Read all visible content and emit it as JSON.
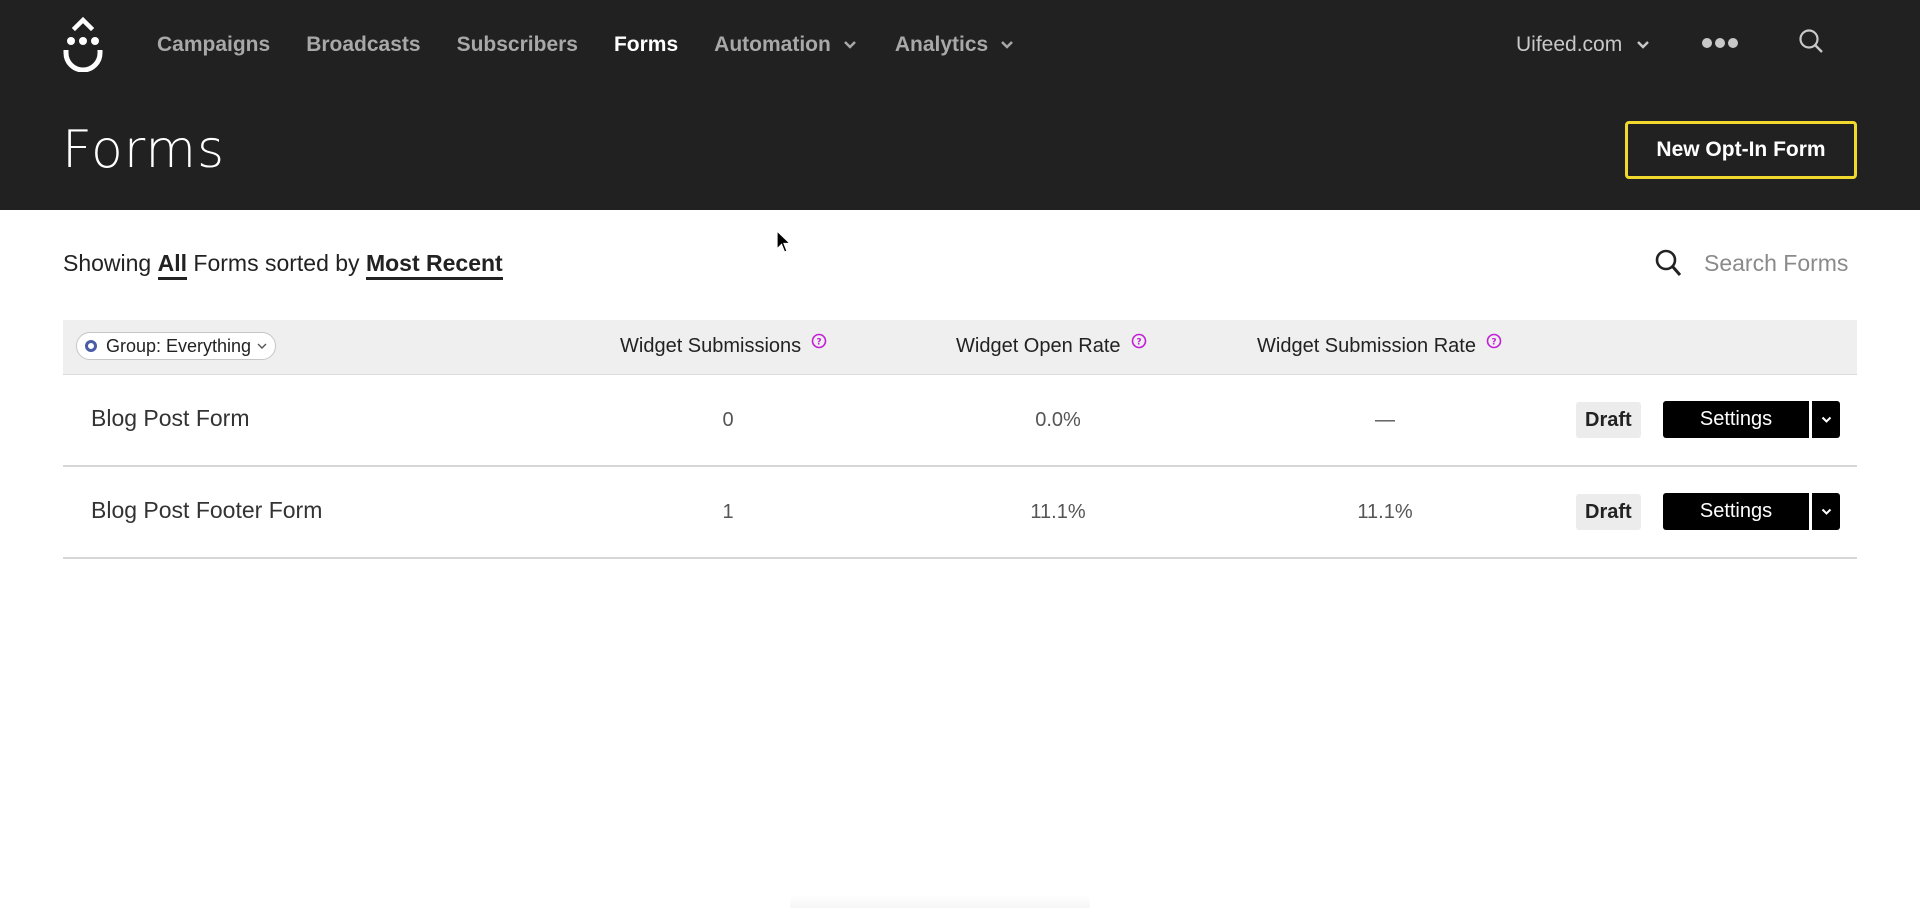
{
  "nav": {
    "items": [
      {
        "label": "Campaigns",
        "active": false,
        "has_dropdown": false
      },
      {
        "label": "Broadcasts",
        "active": false,
        "has_dropdown": false
      },
      {
        "label": "Subscribers",
        "active": false,
        "has_dropdown": false
      },
      {
        "label": "Forms",
        "active": true,
        "has_dropdown": false
      },
      {
        "label": "Automation",
        "active": false,
        "has_dropdown": true
      },
      {
        "label": "Analytics",
        "active": false,
        "has_dropdown": true
      }
    ],
    "account_label": "Uifeed.com",
    "more_icon": "ellipsis-icon",
    "search_icon": "search-icon"
  },
  "header": {
    "title": "Forms",
    "new_button_label": "New Opt-In Form"
  },
  "filter": {
    "prefix": "Showing",
    "filter_value": "All",
    "middle": "Forms sorted by",
    "sort_value": "Most Recent"
  },
  "search": {
    "placeholder": "Search Forms",
    "value": ""
  },
  "table": {
    "group_filter_label": "Group: Everything",
    "columns": [
      {
        "label": "Widget Submissions",
        "help": true
      },
      {
        "label": "Widget Open Rate",
        "help": true
      },
      {
        "label": "Widget Submission Rate",
        "help": true
      }
    ],
    "rows": [
      {
        "name": "Blog Post Form",
        "submissions": "0",
        "open_rate": "0.0%",
        "submission_rate": "—",
        "status": "Draft",
        "action_label": "Settings"
      },
      {
        "name": "Blog Post Footer Form",
        "submissions": "1",
        "open_rate": "11.1%",
        "submission_rate": "11.1%",
        "status": "Draft",
        "action_label": "Settings"
      }
    ]
  },
  "colors": {
    "topbar_bg": "#212121",
    "accent_yellow": "#f0d82c",
    "help_icon": "#c21fd6",
    "group_dot": "#4a5ba8"
  }
}
